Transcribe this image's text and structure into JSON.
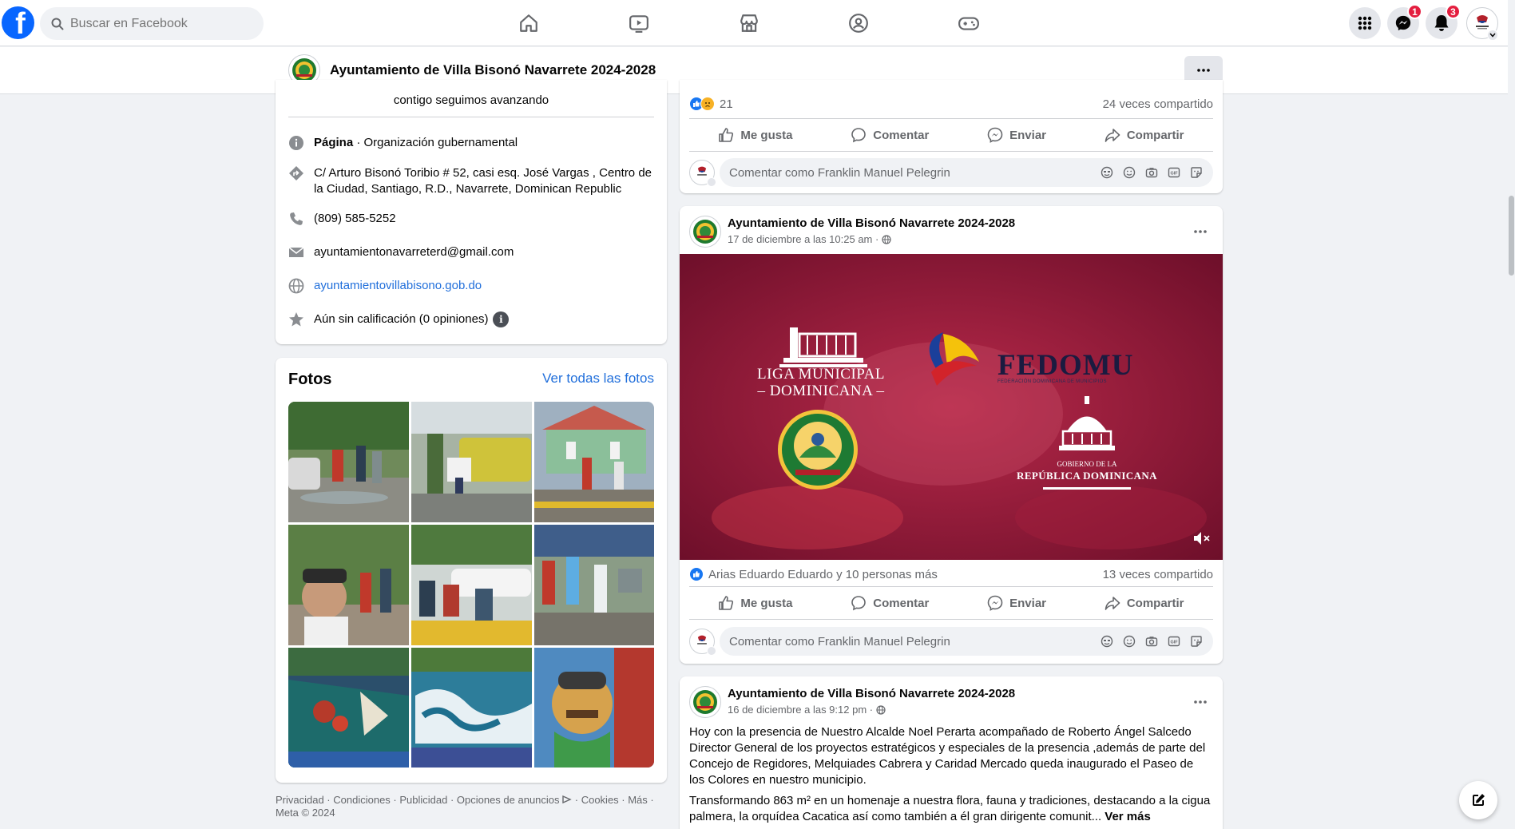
{
  "topbar": {
    "search_placeholder": "Buscar en Facebook",
    "logo_letter": "f",
    "messenger_badge": "1",
    "notifications_badge": "3"
  },
  "pagebar": {
    "title": "Ayuntamiento de Villa Bisonó Navarrete 2024-2028"
  },
  "intro": {
    "tagline": "contigo seguimos avanzando",
    "page_label": "Página",
    "page_category": " · Organización gubernamental",
    "address": "C/ Arturo Bisonó Toribio # 52, casi esq. José Vargas , Centro de la Ciudad, Santiago, R.D., Navarrete, Dominican Republic",
    "phone": "(809) 585-5252",
    "email": "ayuntamientonavarreterd@gmail.com",
    "website": "ayuntamientovillabisono.gob.do",
    "rating": "Aún sin calificación (0 opiniones)"
  },
  "photos": {
    "title": "Fotos",
    "see_all": "Ver todas las fotos"
  },
  "footer": {
    "links": "Privacidad · Condiciones · Publicidad · Opciones de anuncios",
    "links2": " · Cookies · Más ·",
    "copyright": "Meta © 2024"
  },
  "post1": {
    "reaction_count": "21",
    "shares": "24 veces compartido",
    "like": "Me gusta",
    "comment": "Comentar",
    "send": "Enviar",
    "share": "Compartir",
    "comment_placeholder": "Comentar como Franklin Manuel Pelegrin"
  },
  "post2": {
    "author": "Ayuntamiento de Villa Bisonó Navarrete 2024-2028",
    "date": "17 de diciembre a las 10:25 am ·",
    "media": {
      "liga_line1": "LIGA MUNICIPAL",
      "liga_line2": "– DOMINICANA –",
      "fedomu": "FEDOMU",
      "fedomu_sub": "FEDERACIÓN DOMINICANA DE MUNICIPIOS",
      "gob_line1": "GOBIERNO DE LA",
      "gob_line2": "REPÚBLICA DOMINICANA"
    },
    "reactions_text": "Arias Eduardo Eduardo y 10 personas más",
    "shares": "13 veces compartido",
    "like": "Me gusta",
    "comment": "Comentar",
    "send": "Enviar",
    "share": "Compartir",
    "comment_placeholder": "Comentar como Franklin Manuel Pelegrin"
  },
  "post3": {
    "author": "Ayuntamiento de Villa Bisonó Navarrete 2024-2028",
    "date": "16 de diciembre a las 9:12 pm ·",
    "paragraph1": "Hoy con la presencia de Nuestro Alcalde Noel Perarta acompañado de Roberto Ángel Salcedo Director General de los proyectos estratégicos y especiales de la presencia ,además de parte del Concejo de Regidores, Melquiades Cabrera y Caridad Mercado queda inaugurado el Paseo de los Colores en nuestro municipio.",
    "paragraph2": "Transformando 863 m² en un homenaje a nuestra flora, fauna y tradiciones, destacando a la cigua palmera, la orquídea Cacatica así como también a él gran dirigente comunit...",
    "see_more": "Ver más"
  },
  "colors": {
    "brand": "#0866ff",
    "link": "#216fdb",
    "badge": "#e41e3f",
    "media_bg": "#8c1534"
  }
}
